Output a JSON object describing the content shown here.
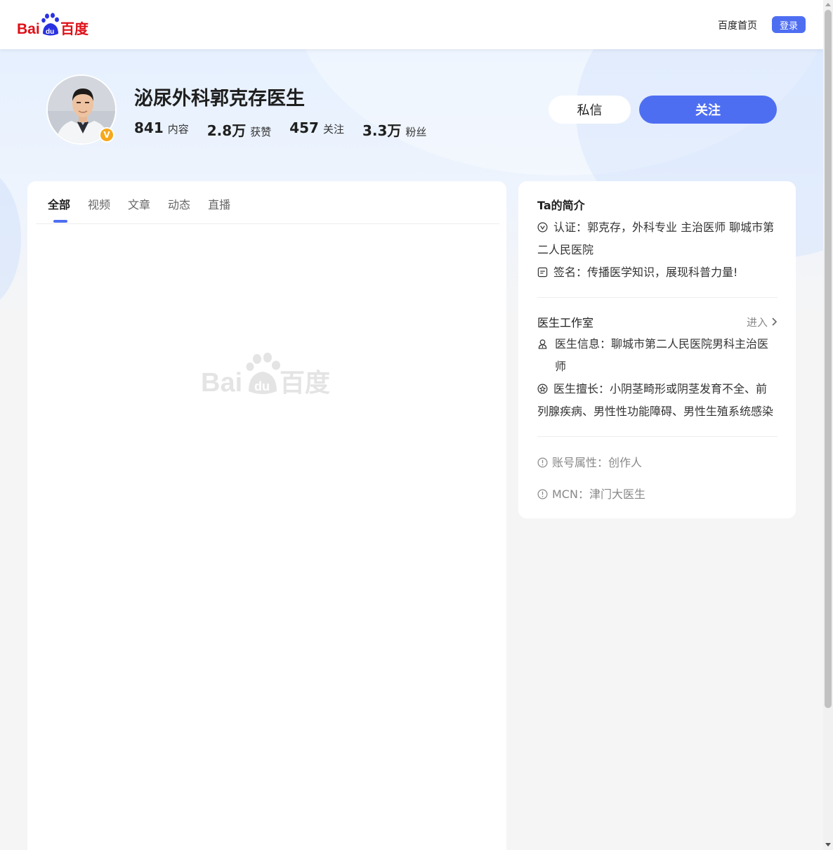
{
  "header": {
    "logo_text_left": "Bai",
    "logo_text_du": "du",
    "logo_text_right": "百度",
    "home_link": "百度首页",
    "login_label": "登录"
  },
  "profile": {
    "name": "泌尿外科郭克存医生",
    "verified_badge": "V",
    "stats": [
      {
        "num": "841",
        "label": "内容"
      },
      {
        "num": "2.8万",
        "label": "获赞"
      },
      {
        "num": "457",
        "label": "关注"
      },
      {
        "num": "3.3万",
        "label": "粉丝"
      }
    ],
    "message_label": "私信",
    "follow_label": "关注"
  },
  "tabs": [
    "全部",
    "视频",
    "文章",
    "动态",
    "直播"
  ],
  "active_tab": "全部",
  "intro": {
    "title": "Ta的简介",
    "certification": "认证：郭克存，外科专业 主治医师 聊城市第二人民医院",
    "signature": "签名：传播医学知识，展现科普力量!"
  },
  "studio": {
    "title": "医生工作室",
    "enter_label": "进入",
    "doctor_info": "医生信息：聊城市第二人民医院男科主治医师",
    "specialty": "医生擅长：小阴茎畸形或阴茎发育不全、前列腺疾病、男性性功能障碍、男性生殖系统感染"
  },
  "attributes": {
    "account_type": "账号属性：创作人",
    "mcn": "MCN：津门大医生"
  },
  "colors": {
    "accent": "#4e6ef2",
    "baidu_red": "#de0f17",
    "baidu_blue": "#2932e1",
    "badge_orange": "#f6a81c"
  }
}
